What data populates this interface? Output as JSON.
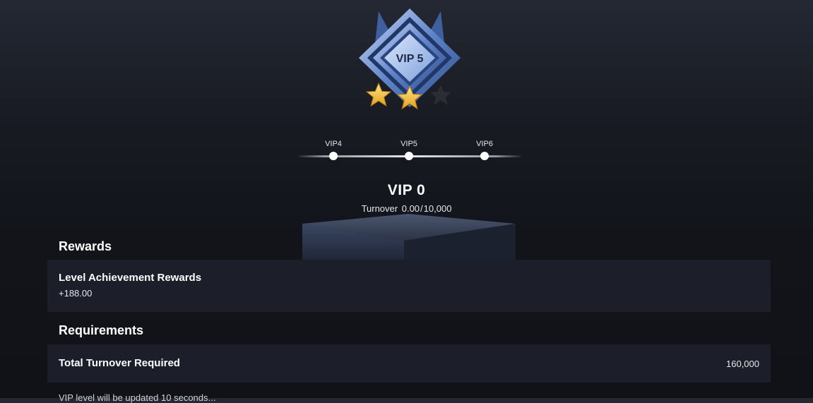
{
  "badge": {
    "label": "VIP 5",
    "stars_filled": 2,
    "stars_total": 3,
    "colors": {
      "frame": "#5b7fc4",
      "frame_light": "#b9cdf1",
      "inner": "#8fb0e6",
      "star": "#f5c542",
      "star_empty": "#2d2f36"
    }
  },
  "progress": {
    "levels": [
      {
        "label": "VIP4"
      },
      {
        "label": "VIP5"
      },
      {
        "label": "VIP6"
      }
    ]
  },
  "current": {
    "title": "VIP 0",
    "turnover_label": "Turnover",
    "turnover_current": "0.00",
    "turnover_target": "10,000"
  },
  "rewards": {
    "section_title": "Rewards",
    "card_title": "Level Achievement Rewards",
    "card_value": "+188.00"
  },
  "requirements": {
    "section_title": "Requirements",
    "card_title": "Total Turnover Required",
    "card_value": "160,000"
  },
  "footnote": "VIP level will be updated 10 seconds...",
  "colors": {
    "card_bg": "#1c1f29",
    "page_top": "#242833",
    "page_bottom": "#101217",
    "text": "#ffffff"
  }
}
